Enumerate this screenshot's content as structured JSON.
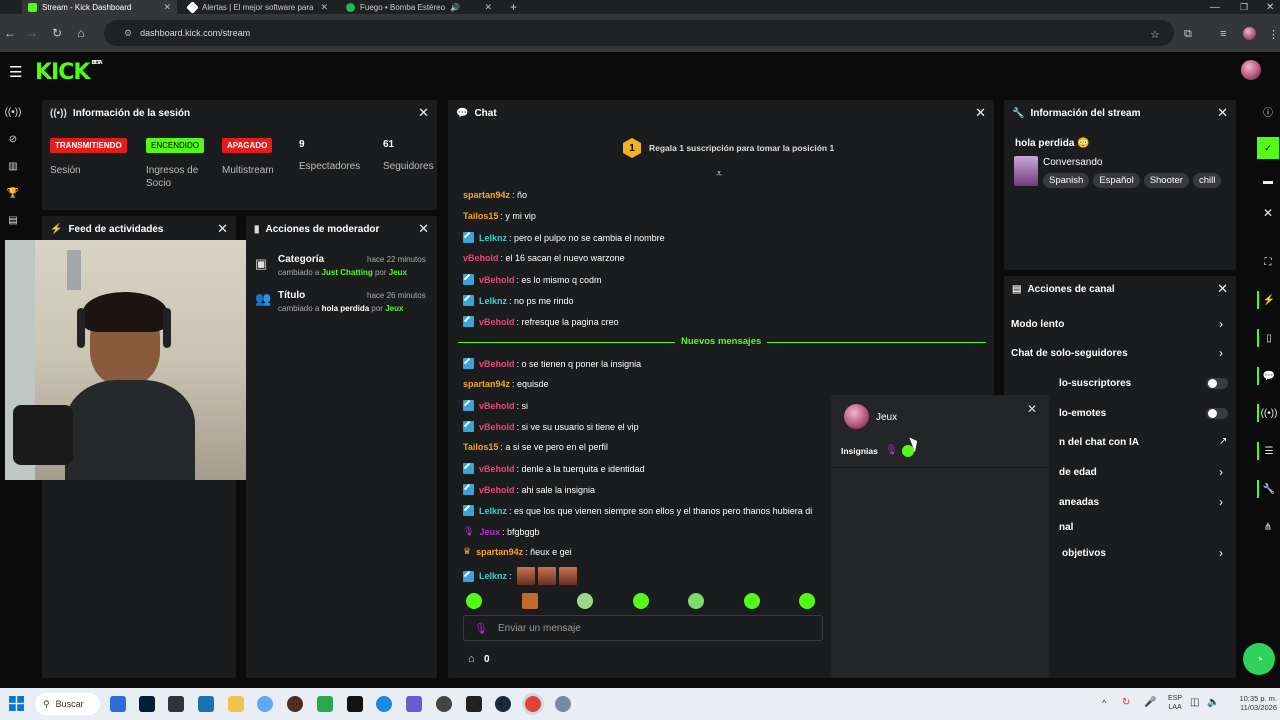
{
  "browser": {
    "tabs": [
      {
        "label": "Stream - Kick Dashboard",
        "active": true
      },
      {
        "label": "Alertas | El mejor software para",
        "active": false
      },
      {
        "label": "Fuego • Bomba Estéreo",
        "active": false
      }
    ],
    "url": "dashboard.kick.com/stream"
  },
  "brand": {
    "logo": "KICK",
    "tag": "BETA",
    "accent": "#53fc18"
  },
  "session": {
    "title": "Información de la sesión",
    "badges": [
      {
        "text": "TRANSMITIENDO",
        "color": "#e41c1c",
        "label": "Sesión"
      },
      {
        "text": "ENCENDIDO",
        "color": "#53fc18",
        "label": "Ingresos de Socio"
      },
      {
        "text": "APAGADO",
        "color": "#e41c1c",
        "label": "Multistream"
      }
    ],
    "viewers": {
      "value": "9",
      "label": "Espectadores"
    },
    "followers": {
      "value": "61",
      "label": "Seguidores"
    }
  },
  "feed": {
    "title": "Feed de actividades"
  },
  "modactions": {
    "title": "Acciones de moderador",
    "items": [
      {
        "name": "Categoría",
        "time": "hace 22 minutos",
        "prefix": "cambiado a",
        "value": "Just Chatting",
        "by": "por",
        "user": "Jeux"
      },
      {
        "name": "Título",
        "time": "hace 26 minutos",
        "prefix": "cambiado a",
        "value": "hola perdida",
        "by": "por",
        "user": "Jeux"
      }
    ]
  },
  "chat": {
    "title": "Chat",
    "pinned": "Regala 1 suscripción para tomar la posición 1",
    "pinned_rank": "1",
    "separator": "Nuevos mensajes",
    "placeholder": "Enviar un mensaje",
    "count": "0",
    "messages": [
      {
        "user": "spartan94z",
        "color": "#f5a623",
        "text": ": ño",
        "badge": false
      },
      {
        "user": "Tailos15",
        "color": "#f5a623",
        "text": ": y mi vip",
        "badge": false
      },
      {
        "user": "Lelknz",
        "color": "#3ad0d0",
        "text": ": pero el pulpo no se cambia el nombre",
        "badge": true
      },
      {
        "user": "vBehold",
        "color": "#e8457a",
        "text": ": el 16 sacan el nuevo warzone",
        "badge": false
      },
      {
        "user": "vBehold",
        "color": "#e8457a",
        "text": ": es lo mismo q codm",
        "badge": true
      },
      {
        "user": "Lelknz",
        "color": "#3ad0d0",
        "text": ": no ps me rindo",
        "badge": true
      },
      {
        "user": "vBehold",
        "color": "#e8457a",
        "text": ": refresque la pagina creo",
        "badge": true
      },
      {
        "user": "vBehold",
        "color": "#e8457a",
        "text": ": o se tienen q poner la insignia",
        "badge": true
      },
      {
        "user": "spartan94z",
        "color": "#f5a623",
        "text": ": equisde",
        "badge": false
      },
      {
        "user": "vBehold",
        "color": "#e8457a",
        "text": ": si",
        "badge": true
      },
      {
        "user": "vBehold",
        "color": "#e8457a",
        "text": ": si ve su usuario si tiene el vip",
        "badge": true
      },
      {
        "user": "Tailos15",
        "color": "#f5a623",
        "text": ": a si se ve pero en el perfil",
        "badge": false
      },
      {
        "user": "vBehold",
        "color": "#e8457a",
        "text": ": denle a la tuerquita e identidad",
        "badge": true
      },
      {
        "user": "vBehold",
        "color": "#e8457a",
        "text": ": ahi sale la insignia",
        "badge": true
      },
      {
        "user": "Lelknz",
        "color": "#3ad0d0",
        "text": ": es que los que vienen siempre son ellos y el thanos pero thanos hubiera di",
        "badge": true
      },
      {
        "user": "Jeux",
        "color": "#c02ad6",
        "text": ": bfgbggb",
        "badge": false
      },
      {
        "user": "spartan94z",
        "color": "#f5a623",
        "text": ": ñeux e gei",
        "badge": false
      },
      {
        "user": "Lelknz",
        "color": "#3ad0d0",
        "text": ":",
        "badge": true
      }
    ]
  },
  "usercard": {
    "name": "Jeux",
    "badges_label": "Insignias"
  },
  "streaminfo": {
    "title": "Información del stream",
    "stream_title": "hola perdida",
    "category": "Conversando",
    "tags": [
      "Spanish",
      "Español",
      "Shooter",
      "chill"
    ]
  },
  "channel": {
    "title": "Acciones de canal",
    "rows": [
      {
        "label": "Modo lento",
        "type": "chevron"
      },
      {
        "label": "Chat de solo-seguidores",
        "type": "chevron"
      },
      {
        "label": "lo-suscriptores",
        "type": "toggle"
      },
      {
        "label": "lo-emotes",
        "type": "toggle"
      },
      {
        "label": "n del chat con IA",
        "type": "external"
      },
      {
        "label": "de edad",
        "type": "chevron"
      },
      {
        "label": "aneadas",
        "type": "chevron"
      },
      {
        "label": "nal",
        "type": "none"
      },
      {
        "label": "objetivos",
        "type": "chevron"
      }
    ]
  },
  "taskbar": {
    "search": "Buscar",
    "lang": "ESP",
    "region": "LAA",
    "time": "10:35 p. m.",
    "date": "11/03/2026"
  }
}
